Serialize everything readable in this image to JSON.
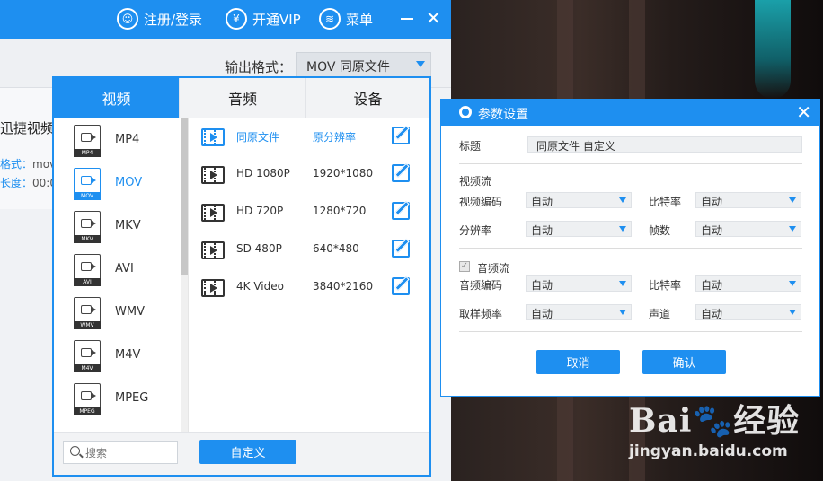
{
  "topbar": {
    "register_login": "注册/登录",
    "vip": "开通VIP",
    "menu": "菜单"
  },
  "output": {
    "label": "输出格式：",
    "value": "MOV  同原文件"
  },
  "left_peek": {
    "title": "迅捷视频",
    "format_label": "格式：",
    "format_value": "mov",
    "duration_label": "长度：",
    "duration_value": "00:0"
  },
  "format_panel": {
    "tabs": [
      {
        "label": "视频",
        "active": true
      },
      {
        "label": "音频",
        "active": false
      },
      {
        "label": "设备",
        "active": false
      }
    ],
    "formats": [
      {
        "name": "MP4",
        "tag": "MP4",
        "active": false
      },
      {
        "name": "MOV",
        "tag": "MOV",
        "active": true
      },
      {
        "name": "MKV",
        "tag": "MKV",
        "active": false
      },
      {
        "name": "AVI",
        "tag": "AVI",
        "active": false
      },
      {
        "name": "WMV",
        "tag": "WMV",
        "active": false
      },
      {
        "name": "M4V",
        "tag": "M4V",
        "active": false
      },
      {
        "name": "MPEG",
        "tag": "MPEG",
        "active": false
      }
    ],
    "presets": [
      {
        "name": "同原文件",
        "res": "原分辨率",
        "active": true
      },
      {
        "name": "HD 1080P",
        "res": "1920*1080",
        "active": false
      },
      {
        "name": "HD 720P",
        "res": "1280*720",
        "active": false
      },
      {
        "name": "SD 480P",
        "res": "640*480",
        "active": false
      },
      {
        "name": "4K Video",
        "res": "3840*2160",
        "active": false
      }
    ],
    "search_placeholder": "搜索",
    "custom_button": "自定义"
  },
  "dialog": {
    "title": "参数设置",
    "title_label": "标题",
    "title_value": "同原文件 自定义",
    "video_section": "视频流",
    "video_codec_label": "视频编码",
    "video_codec_value": "自动",
    "video_bitrate_label": "比特率",
    "video_bitrate_value": "自动",
    "resolution_label": "分辨率",
    "resolution_value": "自动",
    "fps_label": "帧数",
    "fps_value": "自动",
    "audio_section": "音频流",
    "audio_codec_label": "音频编码",
    "audio_codec_value": "自动",
    "audio_bitrate_label": "比特率",
    "audio_bitrate_value": "自动",
    "samplerate_label": "取样频率",
    "samplerate_value": "自动",
    "channels_label": "声道",
    "channels_value": "自动",
    "cancel": "取消",
    "confirm": "确认"
  },
  "watermark": {
    "brand": "Bai",
    "brand2": "经验",
    "url": "jingyan.baidu.com"
  },
  "colors": {
    "accent": "#1e8ff0"
  }
}
